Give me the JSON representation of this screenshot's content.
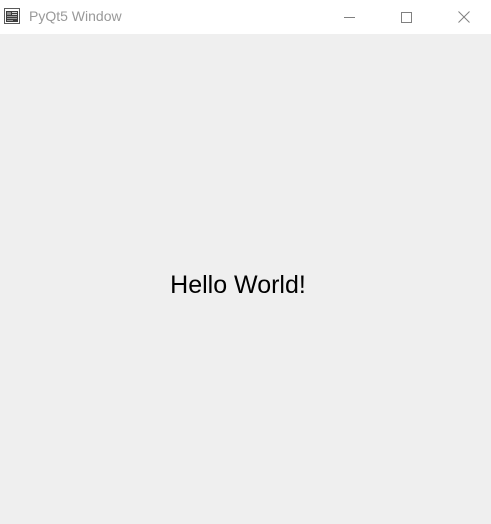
{
  "window": {
    "title": "PyQt5 Window",
    "titlebar_icon": "pyqt-app-icon",
    "controls": {
      "minimize_icon": "minimize-icon",
      "maximize_icon": "maximize-icon",
      "close_icon": "close-icon"
    },
    "colors": {
      "titlebar_background": "#ffffff",
      "title_text": "#999999",
      "client_background": "#efefef",
      "label_text": "#000000"
    }
  },
  "content": {
    "label": "Hello World!"
  }
}
